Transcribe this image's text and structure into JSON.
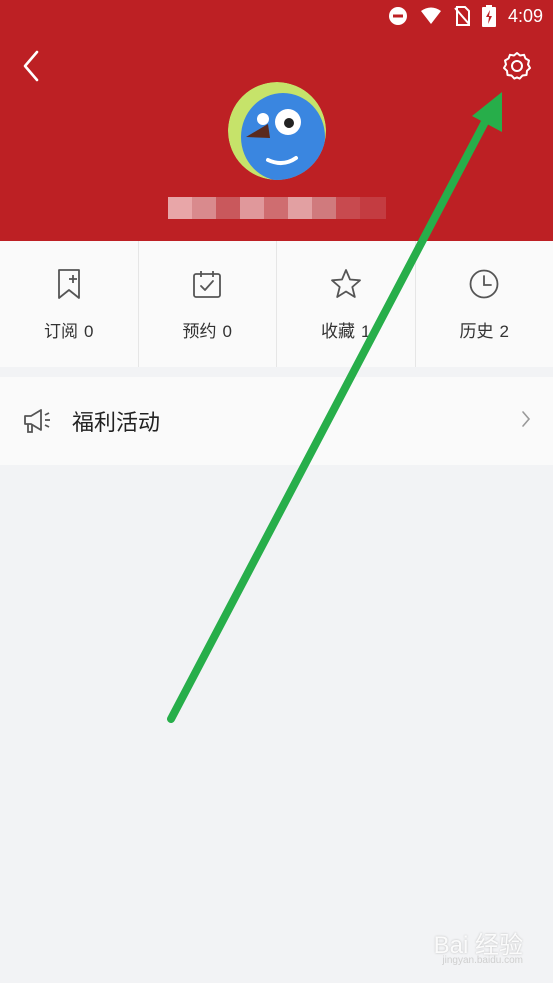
{
  "status_bar": {
    "time": "4:09",
    "icons": [
      "do-not-disturb-icon",
      "wifi-icon",
      "no-sim-icon",
      "battery-charging-icon"
    ]
  },
  "header": {
    "back_icon": "back-arrow-icon",
    "settings_icon": "gear-icon",
    "avatar": "bird-avatar",
    "username": "(pixelated)"
  },
  "stats": [
    {
      "label": "订阅",
      "count": "0",
      "icon": "bookmark-add-icon"
    },
    {
      "label": "预约",
      "count": "0",
      "icon": "calendar-check-icon"
    },
    {
      "label": "收藏",
      "count": "1",
      "icon": "star-icon"
    },
    {
      "label": "历史",
      "count": "2",
      "icon": "clock-icon"
    }
  ],
  "menu": [
    {
      "label": "福利活动",
      "icon": "megaphone-icon"
    }
  ],
  "watermark": {
    "text": "Bai 经验",
    "subtext": "jingyan.baidu.com"
  },
  "colors": {
    "header_red": "#bd2024",
    "background": "#f2f3f5",
    "annotation_arrow": "#27ae4a"
  }
}
